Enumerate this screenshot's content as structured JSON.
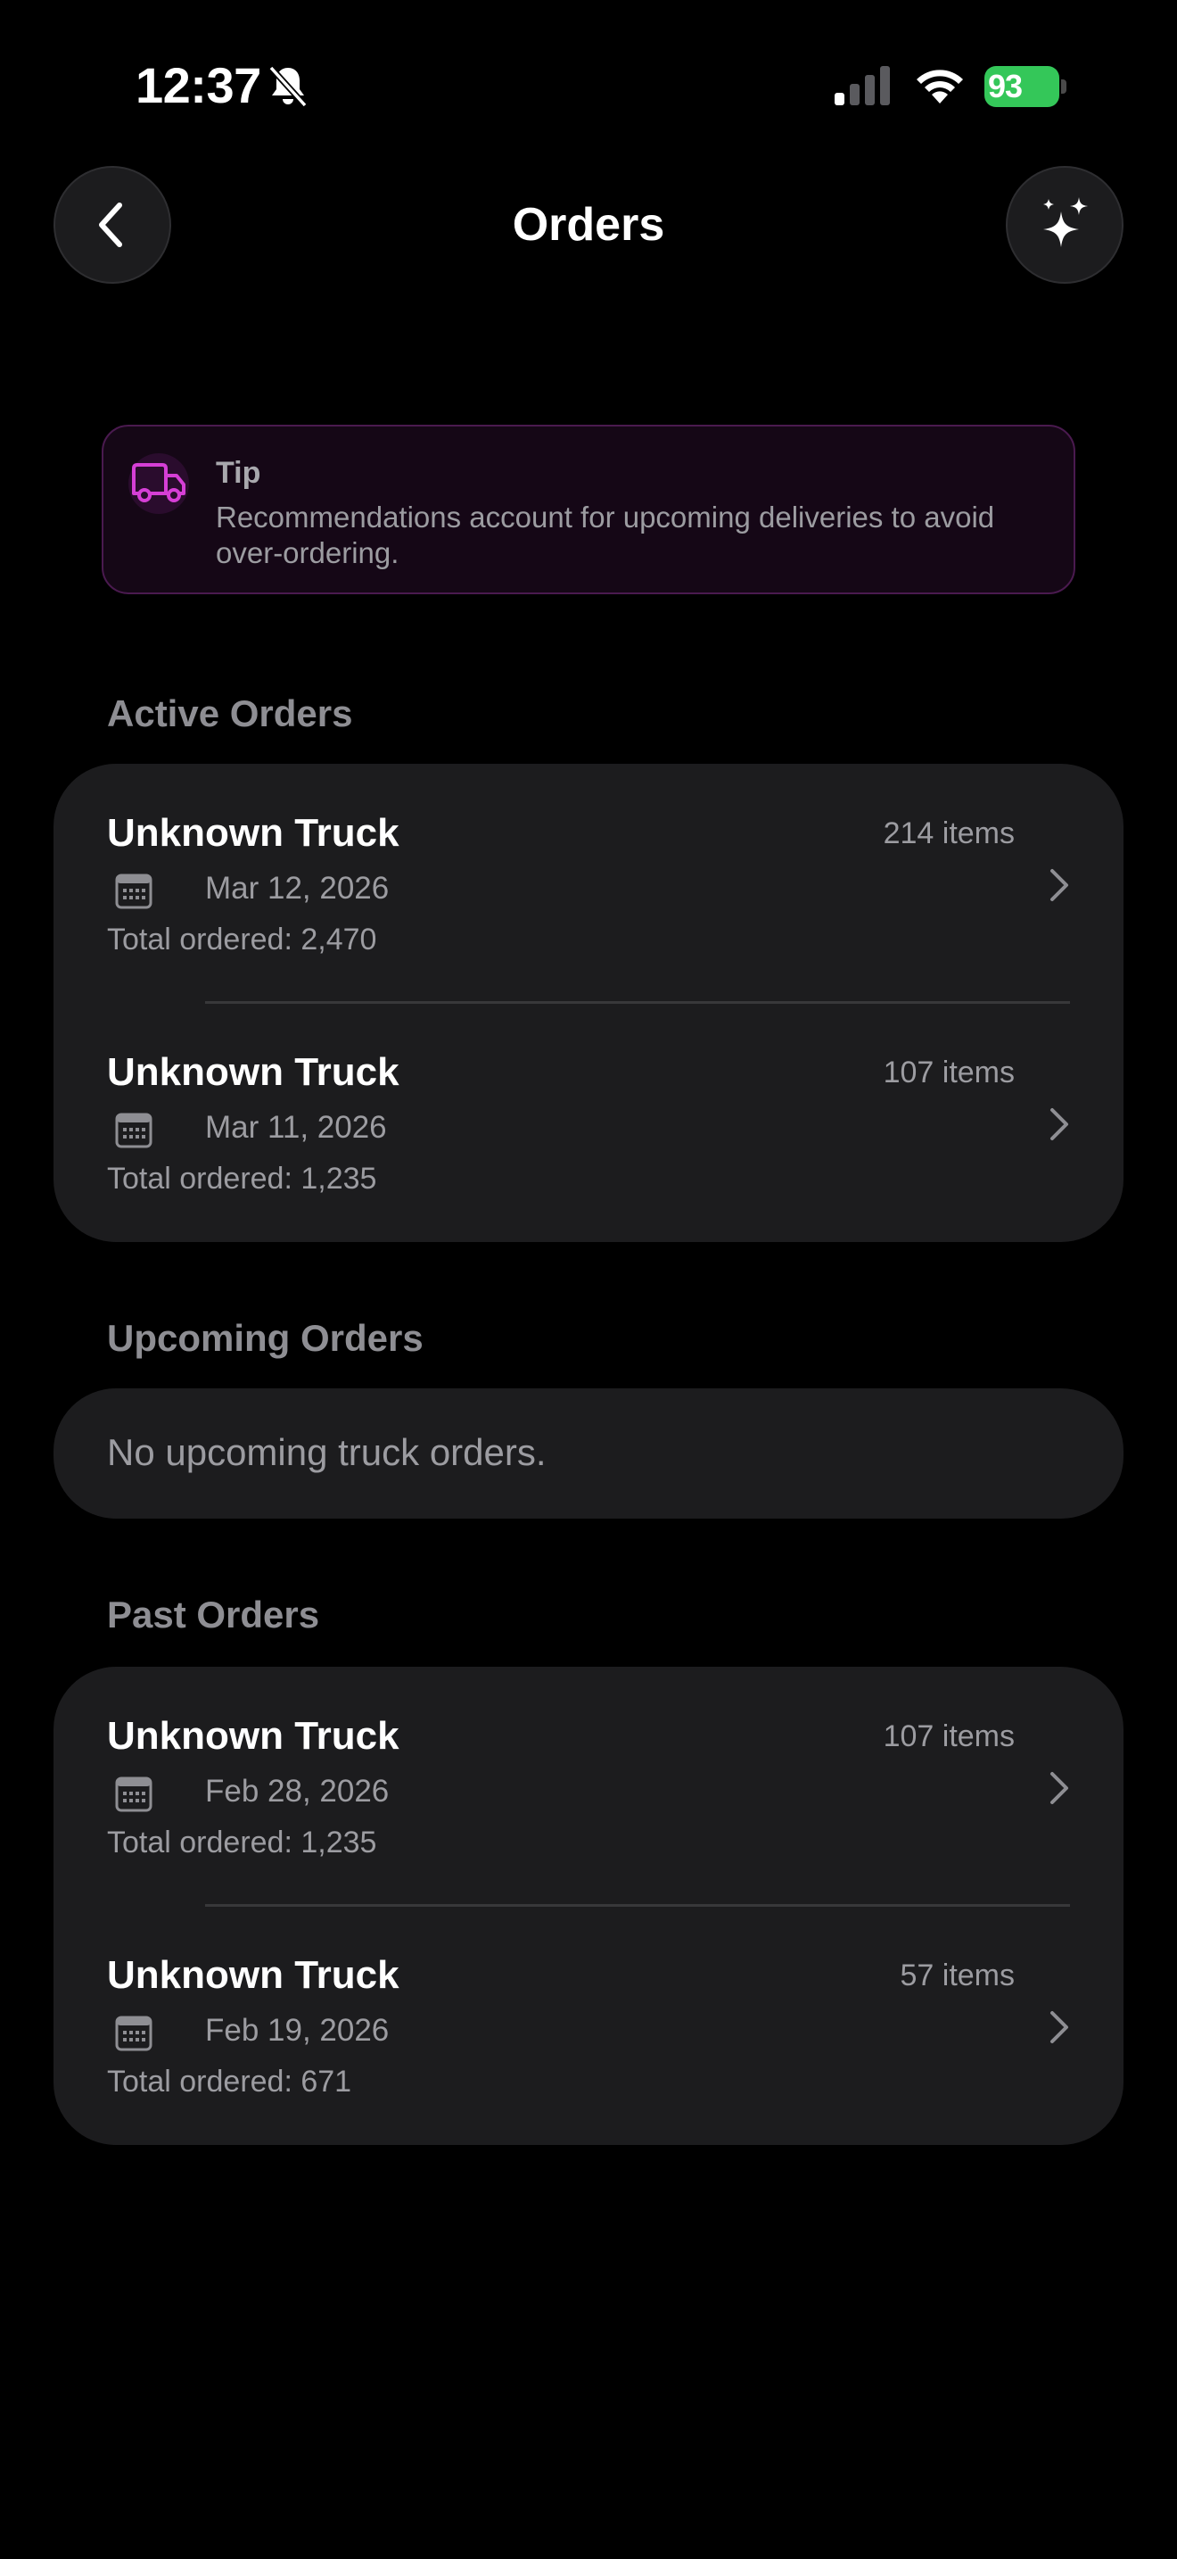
{
  "status_bar": {
    "time": "12:37",
    "battery": "93",
    "icons": [
      "bell-slash-icon",
      "cellular-signal-icon",
      "wifi-icon",
      "battery-charging-icon"
    ]
  },
  "nav": {
    "title": "Orders",
    "back_icon": "chevron-left-icon",
    "ai_icon": "sparkles-icon"
  },
  "tip": {
    "title": "Tip",
    "text": "Recommendations account for upcoming deliveries to avoid over-ordering.",
    "icon": "truck-icon",
    "accent_color": "#d63fd6"
  },
  "sections": {
    "active": {
      "header": "Active Orders",
      "orders": [
        {
          "title": "Unknown Truck",
          "count": "214 items",
          "date": "Mar 12, 2026",
          "total": "Total ordered: 2,470"
        },
        {
          "title": "Unknown Truck",
          "count": "107 items",
          "date": "Mar 11, 2026",
          "total": "Total ordered: 1,235"
        }
      ]
    },
    "upcoming": {
      "header": "Upcoming Orders",
      "empty_text": "No upcoming truck orders."
    },
    "past": {
      "header": "Past Orders",
      "orders": [
        {
          "title": "Unknown Truck",
          "count": "107 items",
          "date": "Feb 28, 2026",
          "total": "Total ordered: 1,235"
        },
        {
          "title": "Unknown Truck",
          "count": "57 items",
          "date": "Feb 19, 2026",
          "total": "Total ordered: 671"
        }
      ]
    }
  },
  "colors": {
    "background": "#000000",
    "card": "#1c1c1e",
    "secondary_text": "#9c9ca1",
    "battery": "#34c759"
  }
}
